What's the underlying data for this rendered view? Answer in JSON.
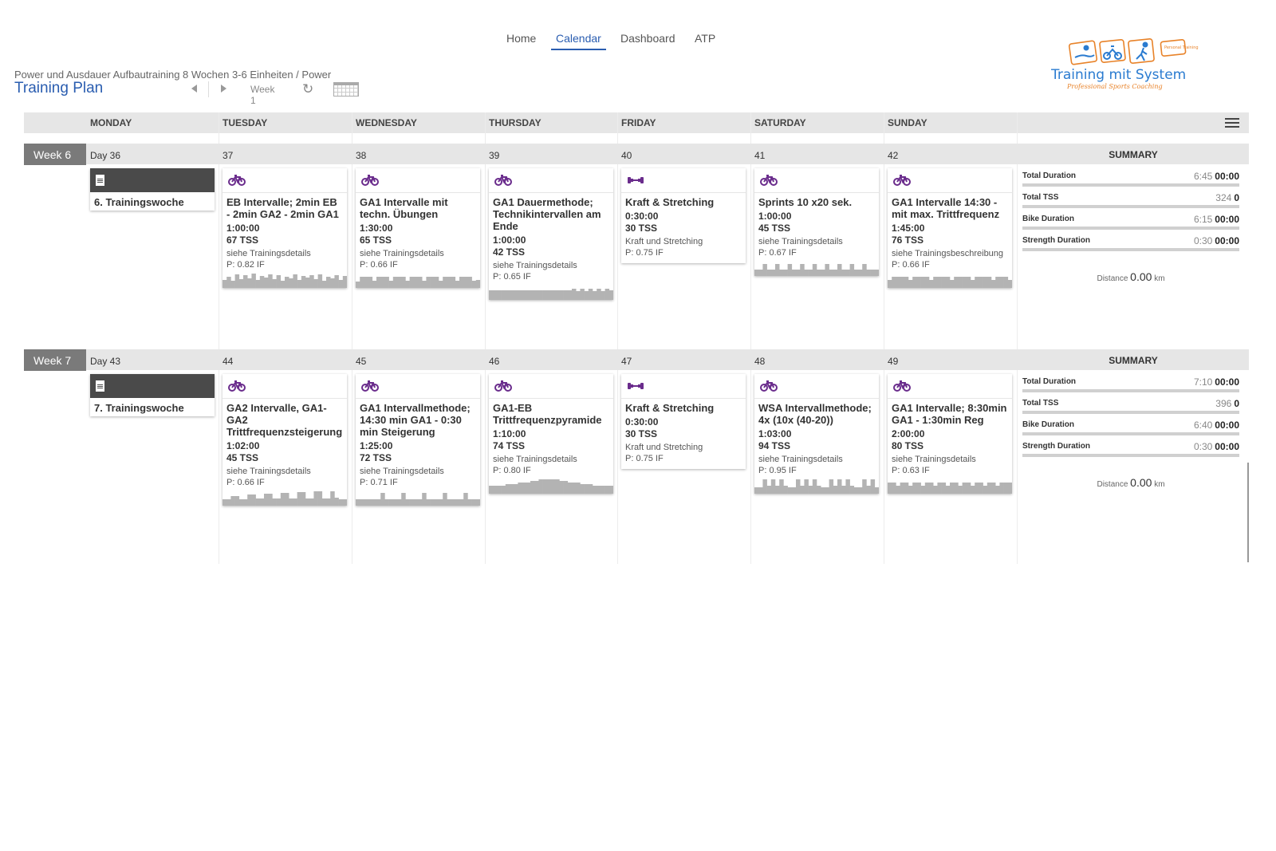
{
  "nav": [
    "Home",
    "Calendar",
    "Dashboard",
    "ATP"
  ],
  "nav_active": "Calendar",
  "breadcrumb": "Power und Ausdauer Aufbautraining 8 Wochen 3-6 Einheiten / Power",
  "page_title": "Training Plan",
  "toolbar": {
    "week_label": "Week 1"
  },
  "logo": {
    "text": "Training mit System",
    "tagline": "Professional Sports Coaching",
    "badge": "Personal Training"
  },
  "days": [
    "MONDAY",
    "TUESDAY",
    "WEDNESDAY",
    "THURSDAY",
    "FRIDAY",
    "SATURDAY",
    "SUNDAY"
  ],
  "colors": {
    "accent": "#2a5db0",
    "bike_icon": "#6a2c8c",
    "header_bg": "#e6e6e6",
    "week_label_bg": "#7a7a7a",
    "note_header": "#4a4a4a"
  },
  "weeks": [
    {
      "label": "Week 6",
      "day_numbers": [
        "Day 36",
        "37",
        "38",
        "39",
        "40",
        "41",
        "42"
      ],
      "note": "6. Trainingswoche",
      "summary_title": "SUMMARY",
      "workouts": [
        {
          "day": 1,
          "icon": "bike-icon",
          "title": "EB Intervalle; 2min EB - 2min GA2 - 2min GA1",
          "duration": "1:00:00",
          "tss": "67 TSS",
          "desc": "siehe Trainingsdetails",
          "if": "P: 0.82 IF",
          "profile": [
            10,
            14,
            9,
            17,
            11,
            16,
            12,
            18,
            10,
            15,
            13,
            17,
            11,
            16,
            9,
            14,
            12,
            17,
            10,
            15,
            13,
            16,
            11,
            17,
            9,
            14,
            12,
            16,
            10,
            15
          ]
        },
        {
          "day": 2,
          "icon": "bike-icon",
          "title": "GA1 Intervalle mit techn. Übungen",
          "duration": "1:30:00",
          "tss": "65 TSS",
          "desc": "siehe Trainingsdetails",
          "if": "P: 0.66 IF",
          "profile": [
            8,
            14,
            14,
            14,
            9,
            14,
            14,
            14,
            9,
            14,
            14,
            14,
            9,
            14,
            14,
            14,
            9,
            14,
            14,
            14,
            9,
            14,
            14,
            14,
            9,
            14,
            14,
            14,
            9,
            10
          ]
        },
        {
          "day": 3,
          "icon": "bike-icon",
          "title": "GA1 Dauermethode; Technikintervallen am Ende",
          "duration": "1:00:00",
          "tss": "42 TSS",
          "desc": "siehe Trainingsdetails",
          "if": "P: 0.65 IF",
          "profile": [
            12,
            12,
            12,
            12,
            12,
            12,
            12,
            12,
            12,
            12,
            12,
            12,
            12,
            12,
            12,
            12,
            12,
            12,
            12,
            12,
            14,
            11,
            14,
            11,
            14,
            11,
            14,
            11,
            14,
            12
          ]
        },
        {
          "day": 4,
          "icon": "strength-icon",
          "title": "Kraft & Stretching",
          "duration": "0:30:00",
          "tss": "30 TSS",
          "desc": "Kraft und Stretching",
          "if": "P: 0.75 IF"
        },
        {
          "day": 5,
          "icon": "bike-icon",
          "title": "Sprints 10 x20 sek.",
          "duration": "1:00:00",
          "tss": "45 TSS",
          "desc": "siehe Trainingsdetails",
          "if": "P: 0.67 IF",
          "profile": [
            8,
            8,
            15,
            8,
            8,
            15,
            8,
            8,
            15,
            8,
            8,
            15,
            8,
            8,
            15,
            8,
            8,
            15,
            8,
            8,
            15,
            8,
            8,
            15,
            8,
            8,
            15,
            8,
            8,
            8
          ]
        },
        {
          "day": 6,
          "icon": "bike-icon",
          "title": "GA1 Intervalle 14:30 - mit max. Trittfrequenz",
          "duration": "1:45:00",
          "tss": "76 TSS",
          "desc": "siehe Trainingsbeschreibung",
          "if": "P: 0.66 IF",
          "profile": [
            10,
            14,
            14,
            14,
            14,
            10,
            14,
            14,
            14,
            14,
            10,
            14,
            14,
            14,
            14,
            10,
            14,
            14,
            14,
            14,
            10,
            14,
            14,
            14,
            14,
            10,
            14,
            14,
            14,
            10
          ]
        }
      ],
      "summary": {
        "rows": [
          {
            "label": "Total Duration",
            "value": "6:45",
            "planned": "00:00"
          },
          {
            "label": "Total TSS",
            "value": "324",
            "planned": "0"
          },
          {
            "label": "Bike Duration",
            "value": "6:15",
            "planned": "00:00"
          },
          {
            "label": "Strength Duration",
            "value": "0:30",
            "planned": "00:00"
          }
        ],
        "distance_label": "Distance",
        "distance_value": "0.00",
        "distance_unit": "km"
      }
    },
    {
      "label": "Week 7",
      "day_numbers": [
        "Day 43",
        "44",
        "45",
        "46",
        "47",
        "48",
        "49"
      ],
      "note": "7. Trainingswoche",
      "summary_title": "SUMMARY",
      "workouts": [
        {
          "day": 1,
          "icon": "bike-icon",
          "title": "GA2 Intervalle, GA1-GA2 Trittfrequenzsteigerung",
          "duration": "1:02:00",
          "tss": "45 TSS",
          "desc": "siehe Trainingsdetails",
          "if": "P: 0.66 IF",
          "profile": [
            8,
            8,
            12,
            12,
            8,
            8,
            14,
            14,
            9,
            9,
            15,
            15,
            9,
            9,
            16,
            16,
            9,
            9,
            17,
            17,
            9,
            9,
            18,
            18,
            9,
            9,
            18,
            10,
            8,
            8
          ]
        },
        {
          "day": 2,
          "icon": "bike-icon",
          "title": "GA1 Intervallmethode; 14:30 min GA1 - 0:30 min Steigerung",
          "duration": "1:25:00",
          "tss": "72 TSS",
          "desc": "siehe Trainingsdetails",
          "if": "P: 0.71 IF",
          "profile": [
            8,
            8,
            8,
            8,
            8,
            8,
            16,
            8,
            8,
            8,
            8,
            16,
            8,
            8,
            8,
            8,
            16,
            8,
            8,
            8,
            8,
            16,
            8,
            8,
            8,
            8,
            16,
            8,
            8,
            8
          ]
        },
        {
          "day": 3,
          "icon": "bike-icon",
          "title": "GA1-EB Trittfrequenzpyramide",
          "duration": "1:10:00",
          "tss": "74 TSS",
          "desc": "siehe Trainingsdetails",
          "if": "P: 0.80 IF",
          "profile": [
            10,
            10,
            10,
            10,
            12,
            12,
            12,
            14,
            14,
            14,
            16,
            16,
            18,
            18,
            18,
            18,
            18,
            16,
            16,
            14,
            14,
            14,
            12,
            12,
            12,
            10,
            10,
            10,
            10,
            10
          ]
        },
        {
          "day": 4,
          "icon": "strength-icon",
          "title": "Kraft & Stretching",
          "duration": "0:30:00",
          "tss": "30 TSS",
          "desc": "Kraft und Stretching",
          "if": "P: 0.75 IF"
        },
        {
          "day": 5,
          "icon": "bike-icon",
          "title": "WSA Intervallmethode; 4x (10x (40-20))",
          "duration": "1:03:00",
          "tss": "94 TSS",
          "desc": "siehe Trainingsdetails",
          "if": "P: 0.95 IF",
          "profile": [
            8,
            8,
            18,
            10,
            18,
            10,
            18,
            10,
            8,
            8,
            18,
            10,
            18,
            10,
            18,
            10,
            8,
            8,
            18,
            10,
            18,
            10,
            18,
            10,
            8,
            8,
            18,
            10,
            18,
            8
          ]
        },
        {
          "day": 6,
          "icon": "bike-icon",
          "title": "GA1 Intervalle; 8:30min GA1 - 1:30min Reg",
          "duration": "2:00:00",
          "tss": "80 TSS",
          "desc": "siehe Trainingsdetails",
          "if": "P: 0.63 IF",
          "profile": [
            14,
            14,
            10,
            14,
            14,
            10,
            14,
            14,
            10,
            14,
            14,
            10,
            14,
            14,
            10,
            14,
            14,
            10,
            14,
            14,
            10,
            14,
            14,
            10,
            14,
            14,
            10,
            14,
            14,
            14
          ]
        }
      ],
      "summary": {
        "rows": [
          {
            "label": "Total Duration",
            "value": "7:10",
            "planned": "00:00"
          },
          {
            "label": "Total TSS",
            "value": "396",
            "planned": "0"
          },
          {
            "label": "Bike Duration",
            "value": "6:40",
            "planned": "00:00"
          },
          {
            "label": "Strength Duration",
            "value": "0:30",
            "planned": "00:00"
          }
        ],
        "distance_label": "Distance",
        "distance_value": "0.00",
        "distance_unit": "km"
      }
    }
  ]
}
